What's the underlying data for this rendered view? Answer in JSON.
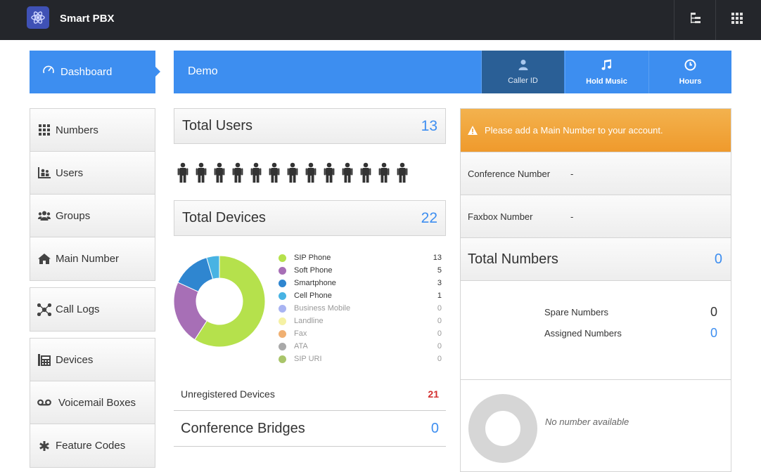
{
  "app": {
    "title": "Smart PBX"
  },
  "nav": {
    "dashboard_label": "Dashboard"
  },
  "account": {
    "name": "Demo",
    "tabs": [
      {
        "label": "Caller ID",
        "icon": "user-icon"
      },
      {
        "label": "Hold Music",
        "icon": "music-note-icon"
      },
      {
        "label": "Hours",
        "icon": "clock-icon"
      }
    ]
  },
  "menu": {
    "group1": [
      {
        "label": "Numbers",
        "icon": "grid-icon"
      },
      {
        "label": "Users",
        "icon": "users-icon"
      },
      {
        "label": "Groups",
        "icon": "groups-icon"
      },
      {
        "label": "Main Number",
        "icon": "home-icon"
      }
    ],
    "group2": [
      {
        "label": "Call Logs",
        "icon": "call-logs-icon"
      }
    ],
    "group3": [
      {
        "label": "Devices",
        "icon": "fax-icon"
      },
      {
        "label": "Voicemail Boxes",
        "icon": "voicemail-icon"
      },
      {
        "label": "Feature Codes",
        "icon": "asterisk-icon"
      }
    ]
  },
  "stats": {
    "total_users_label": "Total Users",
    "total_users": "13",
    "user_icon_count": 13,
    "total_devices_label": "Total Devices",
    "total_devices": "22",
    "unregistered_label": "Unregistered Devices",
    "unregistered": "21",
    "conference_label": "Conference Bridges",
    "conference": "0"
  },
  "chart_data": {
    "type": "pie",
    "title": "",
    "series": [
      {
        "name": "SIP Phone",
        "value": 13,
        "color": "#b5e14c"
      },
      {
        "name": "Soft Phone",
        "value": 5,
        "color": "#a76fb6"
      },
      {
        "name": "Smartphone",
        "value": 3,
        "color": "#2f86d0"
      },
      {
        "name": "Cell Phone",
        "value": 1,
        "color": "#48b3e3"
      },
      {
        "name": "Business Mobile",
        "value": 0,
        "color": "#a9b4f2"
      },
      {
        "name": "Landline",
        "value": 0,
        "color": "#f5f1a4"
      },
      {
        "name": "Fax",
        "value": 0,
        "color": "#f0b072"
      },
      {
        "name": "ATA",
        "value": 0,
        "color": "#a9a9a9"
      },
      {
        "name": "SIP URI",
        "value": 0,
        "color": "#a9c56a"
      }
    ]
  },
  "numbers": {
    "alert": "Please add a Main Number to your account.",
    "conference_number_label": "Conference Number",
    "conference_number": "-",
    "faxbox_number_label": "Faxbox Number",
    "faxbox_number": "-",
    "total_label": "Total Numbers",
    "total": "0",
    "spare_label": "Spare Numbers",
    "spare": "0",
    "assigned_label": "Assigned Numbers",
    "assigned": "0",
    "empty_text": "No number available"
  }
}
